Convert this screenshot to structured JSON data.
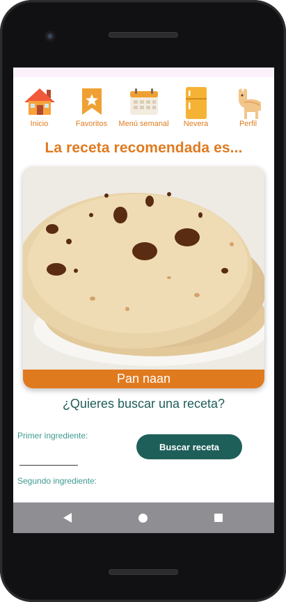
{
  "nav": {
    "items": [
      {
        "label": "Inicio",
        "icon": "house-icon"
      },
      {
        "label": "Favoritos",
        "icon": "bookmark-star-icon"
      },
      {
        "label": "Menú semanal",
        "icon": "calendar-icon"
      },
      {
        "label": "Nevera",
        "icon": "fridge-icon"
      },
      {
        "label": "Perfil",
        "icon": "llama-icon"
      }
    ]
  },
  "recommendation": {
    "headline": "La receta recomendada es...",
    "recipe_name": "Pan naan",
    "image": "naan-flatbread-photo"
  },
  "search": {
    "question": "¿Quieres buscar una receta?",
    "first_ingredient_label": "Primer ingrediente:",
    "first_ingredient_value": "",
    "second_ingredient_label": "Segundo ingrediente:",
    "button_label": "Buscar receta"
  },
  "system_nav": {
    "back": "back-triangle-icon",
    "home": "home-circle-icon",
    "recents": "recents-square-icon"
  },
  "colors": {
    "accent_orange": "#e07a1f",
    "teal_dark": "#1f5f5a",
    "teal_text": "#3e9a8f",
    "system_nav": "#8e8e93"
  }
}
